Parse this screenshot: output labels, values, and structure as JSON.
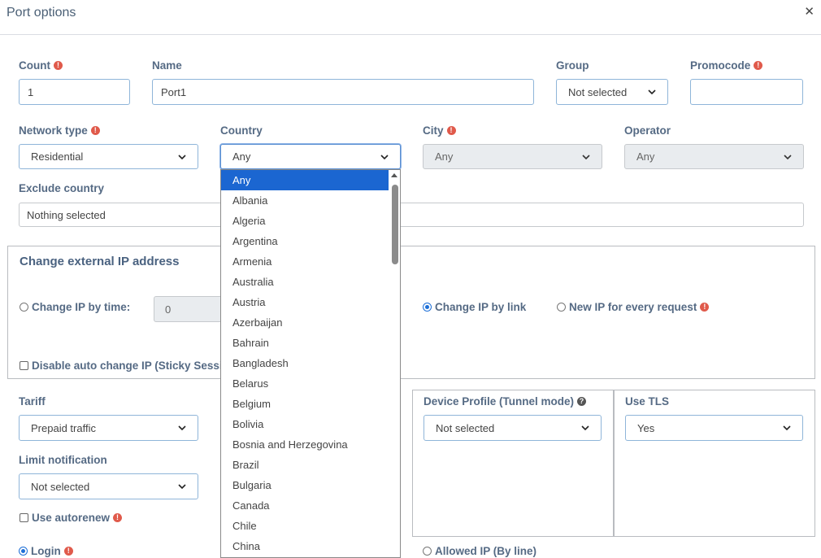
{
  "dialog": {
    "title": "Port options"
  },
  "fields": {
    "count": {
      "label": "Count",
      "value": "1"
    },
    "name": {
      "label": "Name",
      "value": "Port1"
    },
    "group": {
      "label": "Group",
      "value": "Not selected"
    },
    "promocode": {
      "label": "Promocode",
      "value": ""
    },
    "network_type": {
      "label": "Network type",
      "value": "Residential"
    },
    "country": {
      "label": "Country",
      "value": "Any"
    },
    "city": {
      "label": "City",
      "value": "Any"
    },
    "operator": {
      "label": "Operator",
      "value": "Any"
    },
    "exclude_country": {
      "label": "Exclude country",
      "value": "Nothing selected"
    }
  },
  "change_ip": {
    "heading": "Change external IP address",
    "by_time_label": "Change IP by time:",
    "by_time_value": "0",
    "by_link_label": "Change IP by link",
    "new_ip_label": "New IP for every request",
    "disable_auto_label": "Disable auto change IP (Sticky Session)",
    "selected": "by_link"
  },
  "tariff": {
    "label": "Tariff",
    "value": "Prepaid traffic"
  },
  "limit_notification": {
    "label": "Limit notification",
    "value": "Not selected"
  },
  "use_autorenew": {
    "label": "Use autorenew"
  },
  "device_profile": {
    "label": "Device Profile (Tunnel mode)",
    "value": "Not selected"
  },
  "use_tls": {
    "label": "Use TLS",
    "value": "Yes"
  },
  "auth": {
    "login_label": "Login",
    "allowed_ip_label": "Allowed IP (By line)",
    "selected": "login"
  },
  "country_dropdown": {
    "options": [
      "Any",
      "Albania",
      "Algeria",
      "Argentina",
      "Armenia",
      "Australia",
      "Austria",
      "Azerbaijan",
      "Bahrain",
      "Bangladesh",
      "Belarus",
      "Belgium",
      "Bolivia",
      "Bosnia and Herzegovina",
      "Brazil",
      "Bulgaria",
      "Canada",
      "Chile",
      "China"
    ],
    "selected": "Any"
  },
  "colors": {
    "accent": "#1b66d1",
    "label": "#556a84",
    "warning": "#e05a4b",
    "border": "#8fb5d9"
  }
}
